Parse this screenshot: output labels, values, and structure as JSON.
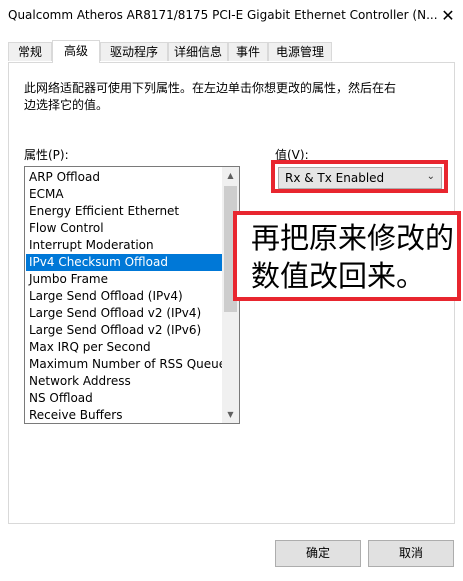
{
  "window": {
    "title": "Qualcomm Atheros AR8171/8175 PCI-E Gigabit Ethernet Controller (N...",
    "close_glyph": "✕"
  },
  "tabs": [
    {
      "label": "常规"
    },
    {
      "label": "高级"
    },
    {
      "label": "驱动程序"
    },
    {
      "label": "详细信息"
    },
    {
      "label": "事件"
    },
    {
      "label": "电源管理"
    }
  ],
  "panel": {
    "description": "此网络适配器可使用下列属性。在左边单击你想更改的属性，然后在右边选择它的值。",
    "property_label": "属性(P):",
    "value_label": "值(V):",
    "properties": [
      "ARP Offload",
      "ECMA",
      "Energy Efficient Ethernet",
      "Flow Control",
      "Interrupt Moderation",
      "IPv4 Checksum Offload",
      "Jumbo Frame",
      "Large Send Offload (IPv4)",
      "Large Send Offload v2 (IPv4)",
      "Large Send Offload v2 (IPv6)",
      "Max IRQ per Second",
      "Maximum Number of RSS Queue",
      "Network Address",
      "NS Offload",
      "Receive Buffers"
    ],
    "selected_index": 5,
    "value_selected": "Rx & Tx Enabled"
  },
  "annotation": {
    "text": "再把原来修改的数值改回来。",
    "color": "#e8262f"
  },
  "buttons": {
    "ok": "确定",
    "cancel": "取消"
  },
  "colors": {
    "selection": "#0078d7",
    "accent_red": "#e8262f"
  }
}
